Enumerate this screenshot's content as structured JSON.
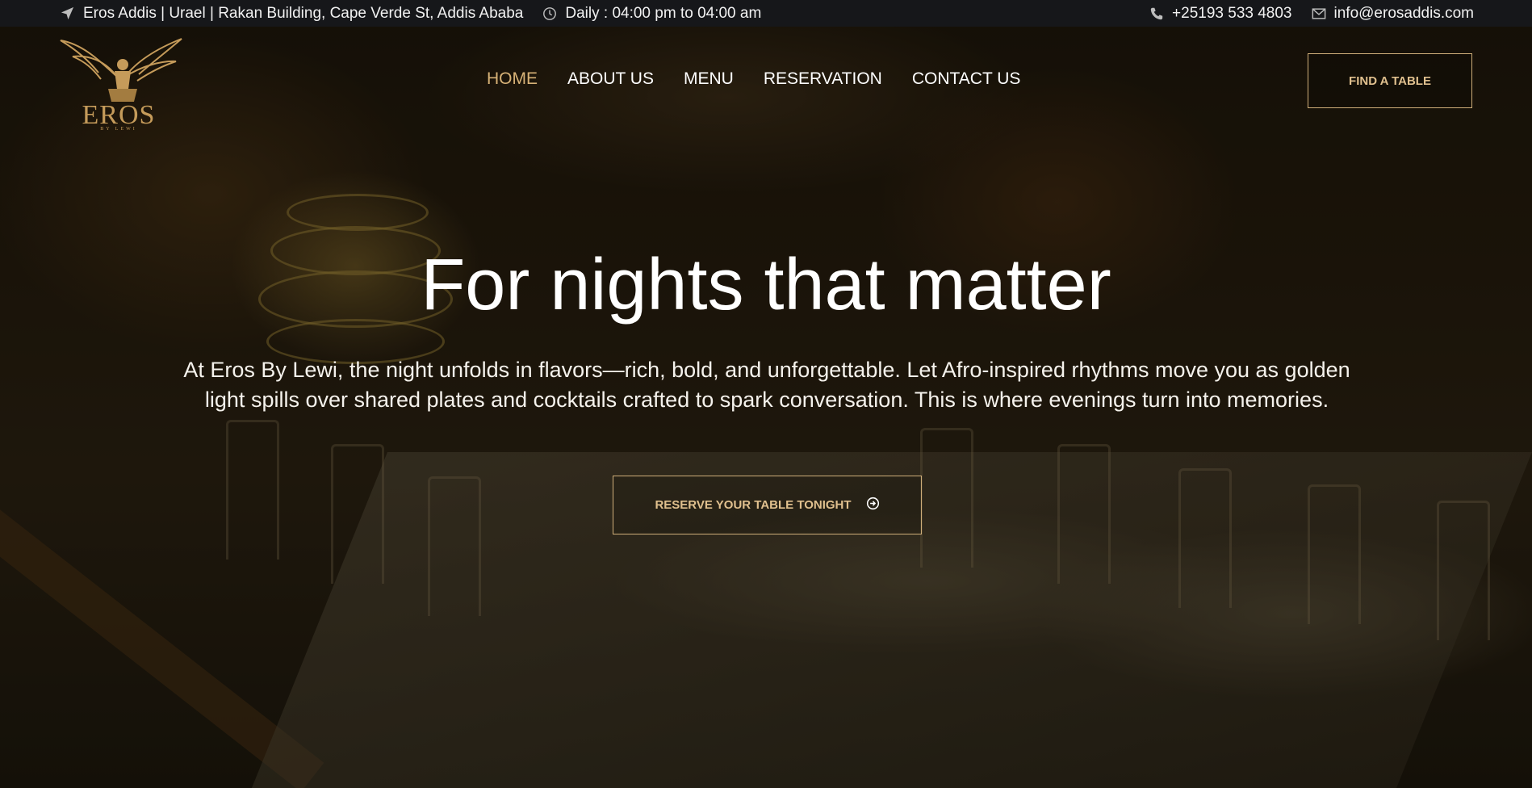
{
  "topbar": {
    "address": "Eros Addis | Urael | Rakan Building, Cape Verde St, Addis Ababa",
    "hours": "Daily : 04:00 pm to 04:00 am",
    "phone": "+25193 533 4803",
    "email": "info@erosaddis.com",
    "icons": [
      "location-arrow-icon",
      "clock-icon",
      "phone-icon",
      "envelope-icon"
    ]
  },
  "brand": {
    "name": "EROS",
    "tagline": "BY LEWI"
  },
  "nav": {
    "items": [
      {
        "label": "HOME",
        "active": true
      },
      {
        "label": "ABOUT US",
        "active": false
      },
      {
        "label": "MENU",
        "active": false
      },
      {
        "label": "RESERVATION",
        "active": false
      },
      {
        "label": "CONTACT US",
        "active": false
      }
    ],
    "cta_label": "FIND A TABLE"
  },
  "hero": {
    "title": "For nights that matter",
    "description": "At Eros By Lewi, the night unfolds in flavors—rich, bold, and unforgettable. Let Afro-inspired rhythms move you as golden light spills over shared plates and cocktails crafted to spark conversation. This is where evenings turn into memories.",
    "button_label": "RESERVE YOUR TABLE TONIGHT",
    "button_icon": "arrow-circle-right-icon"
  },
  "colors": {
    "topbar_bg": "#16171a",
    "accent_gold": "#d7b277",
    "text_white": "#ffffff"
  }
}
